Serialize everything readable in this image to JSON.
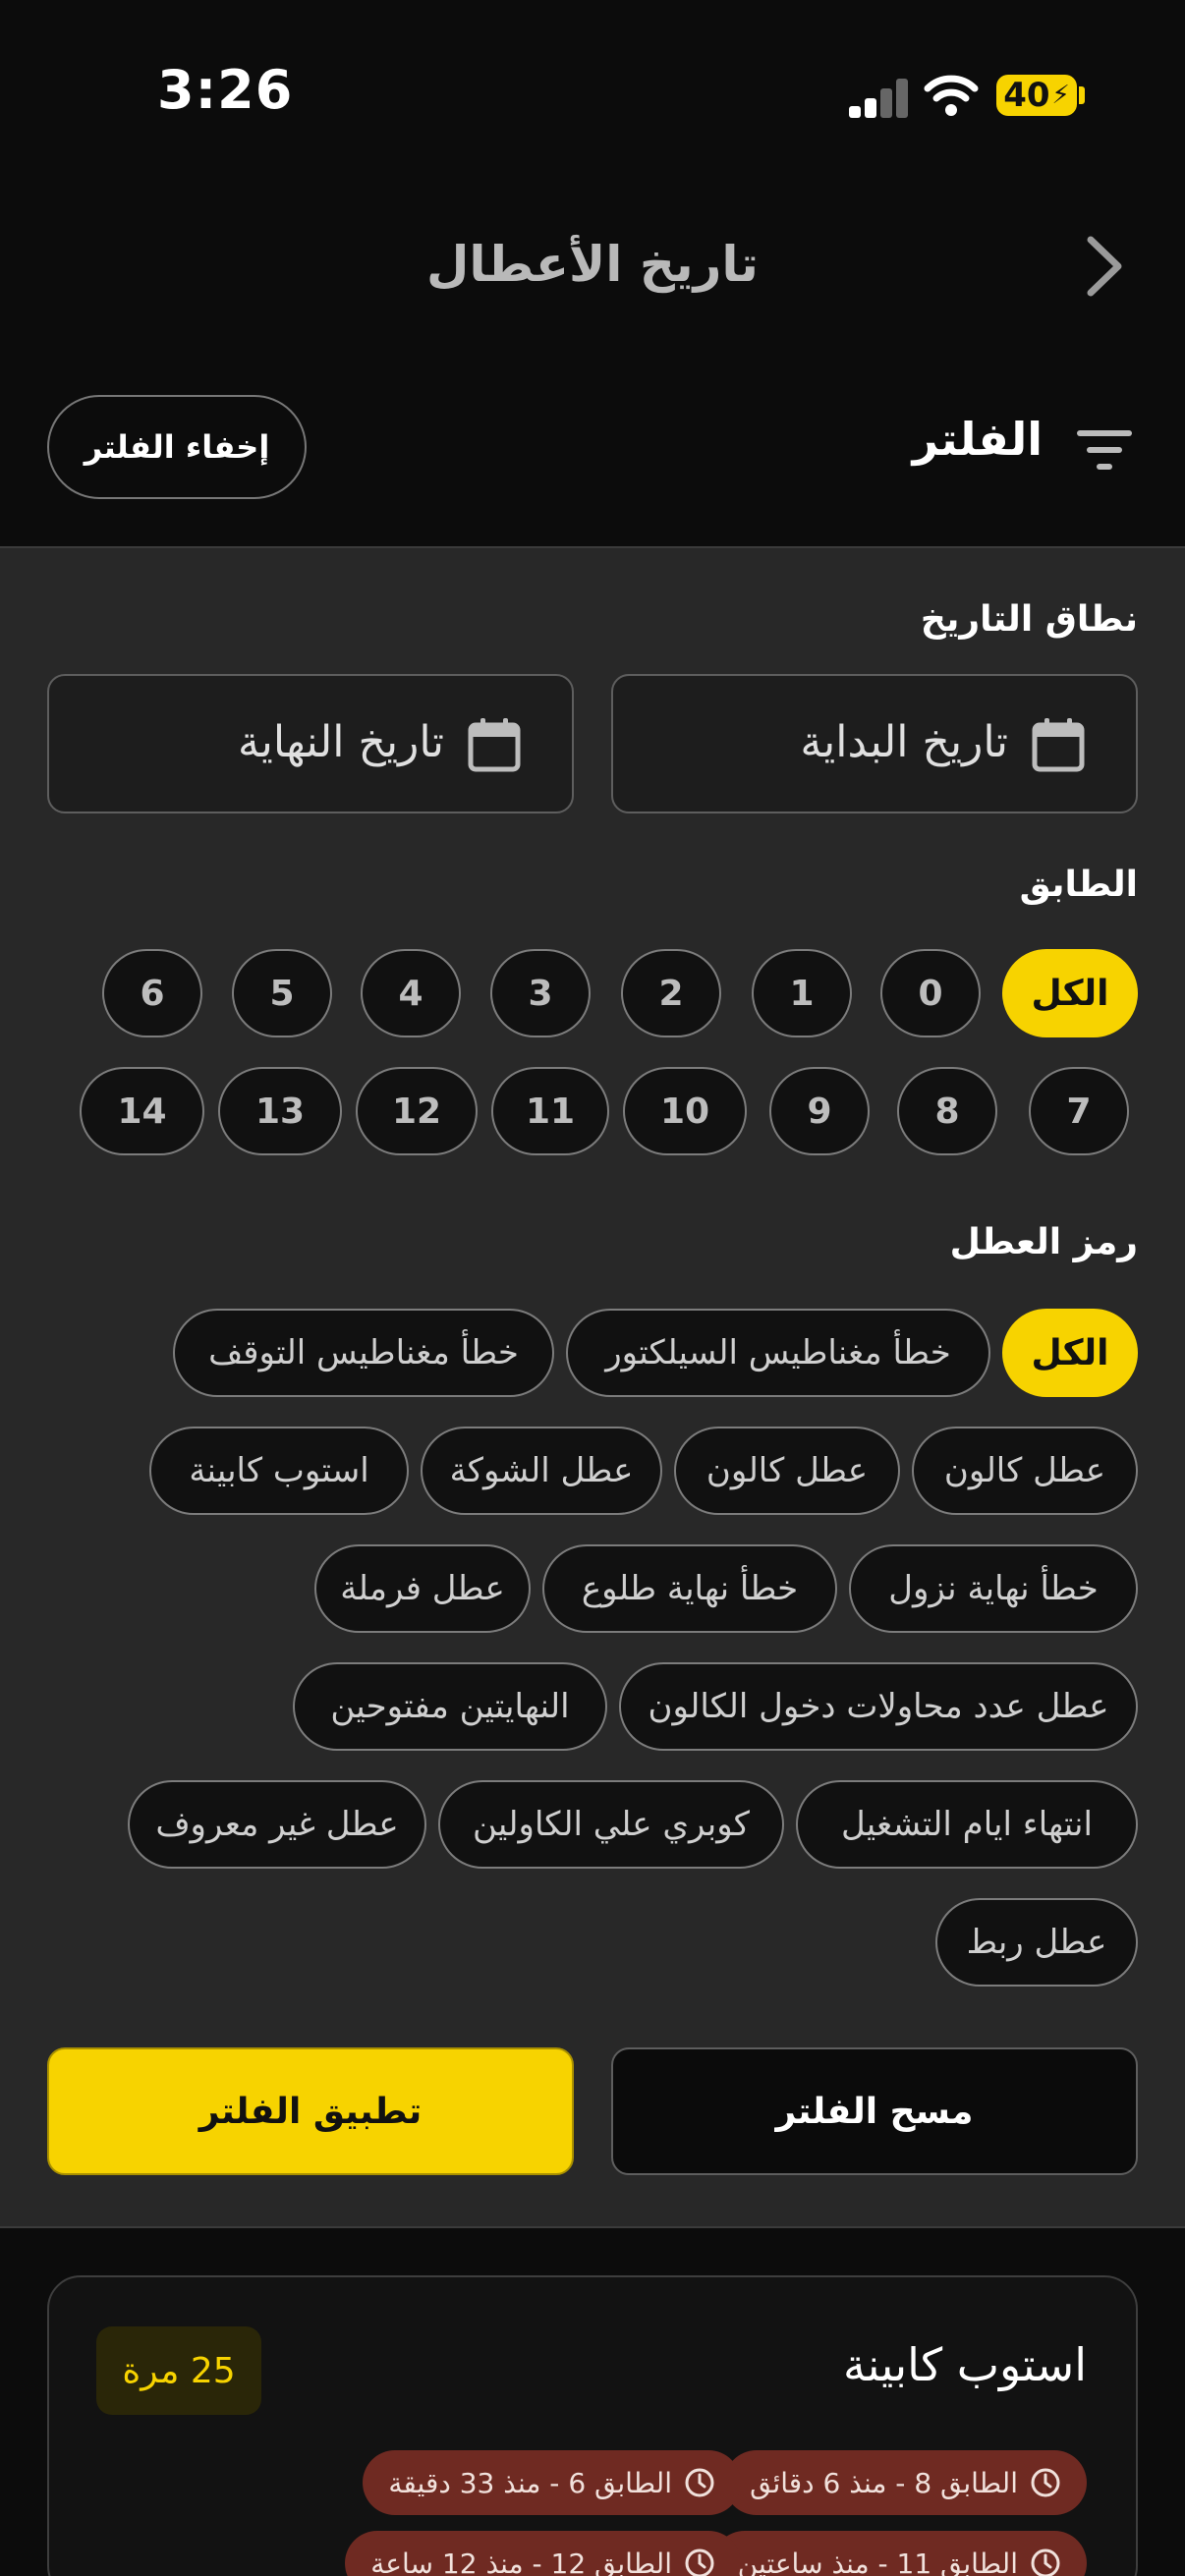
{
  "status_bar": {
    "time": "3:26",
    "battery": "40"
  },
  "header": {
    "title": "تاريخ الأعطال",
    "back_icon": "chevron-right-icon"
  },
  "filter": {
    "title": "الفلتر",
    "hide_label": "إخفاء الفلتر",
    "icon": "filter-lines-icon"
  },
  "date_range": {
    "label": "نطاق التاريخ",
    "start": "تاريخ البداية",
    "end": "تاريخ النهاية"
  },
  "floors": {
    "label": "الطابق",
    "all": "الكل",
    "row1": [
      "0",
      "1",
      "2",
      "3",
      "4",
      "5",
      "6"
    ],
    "row2": [
      "7",
      "8",
      "9",
      "10",
      "11",
      "12",
      "13",
      "14"
    ]
  },
  "fault_codes": {
    "label": "رمز العطل",
    "all": "الكل",
    "items": [
      "خطأ مغناطيس السيلكتور",
      "خطأ مغناطيس التوقف",
      "عطل كالون",
      "عطل كالون",
      "عطل الشوكة",
      "استوب كابينة",
      "خطأ نهاية نزول",
      "خطأ نهاية طلوع",
      "عطل فرملة",
      "عطل عدد محاولات دخول الكالون",
      "النهايتين مفتوحين",
      "انتهاء ايام التشغيل",
      "كوبري علي الكاولين",
      "عطل غير معروف",
      "عطل ربط"
    ]
  },
  "actions": {
    "apply": "تطبيق الفلتر",
    "clear": "مسح الفلتر"
  },
  "card": {
    "title": "استوب كابينة",
    "count": "25 مرة",
    "occurrences": [
      "الطابق 8 - منذ 6 دقائق",
      "الطابق 6 - منذ 33 دقيقة",
      "الطابق 11 - منذ ساعتين",
      "الطابق 12 - منذ 12 ساعة"
    ]
  },
  "colors": {
    "accent": "#f7d300",
    "panel": "#282828",
    "occurrence": "#6f2a22"
  }
}
